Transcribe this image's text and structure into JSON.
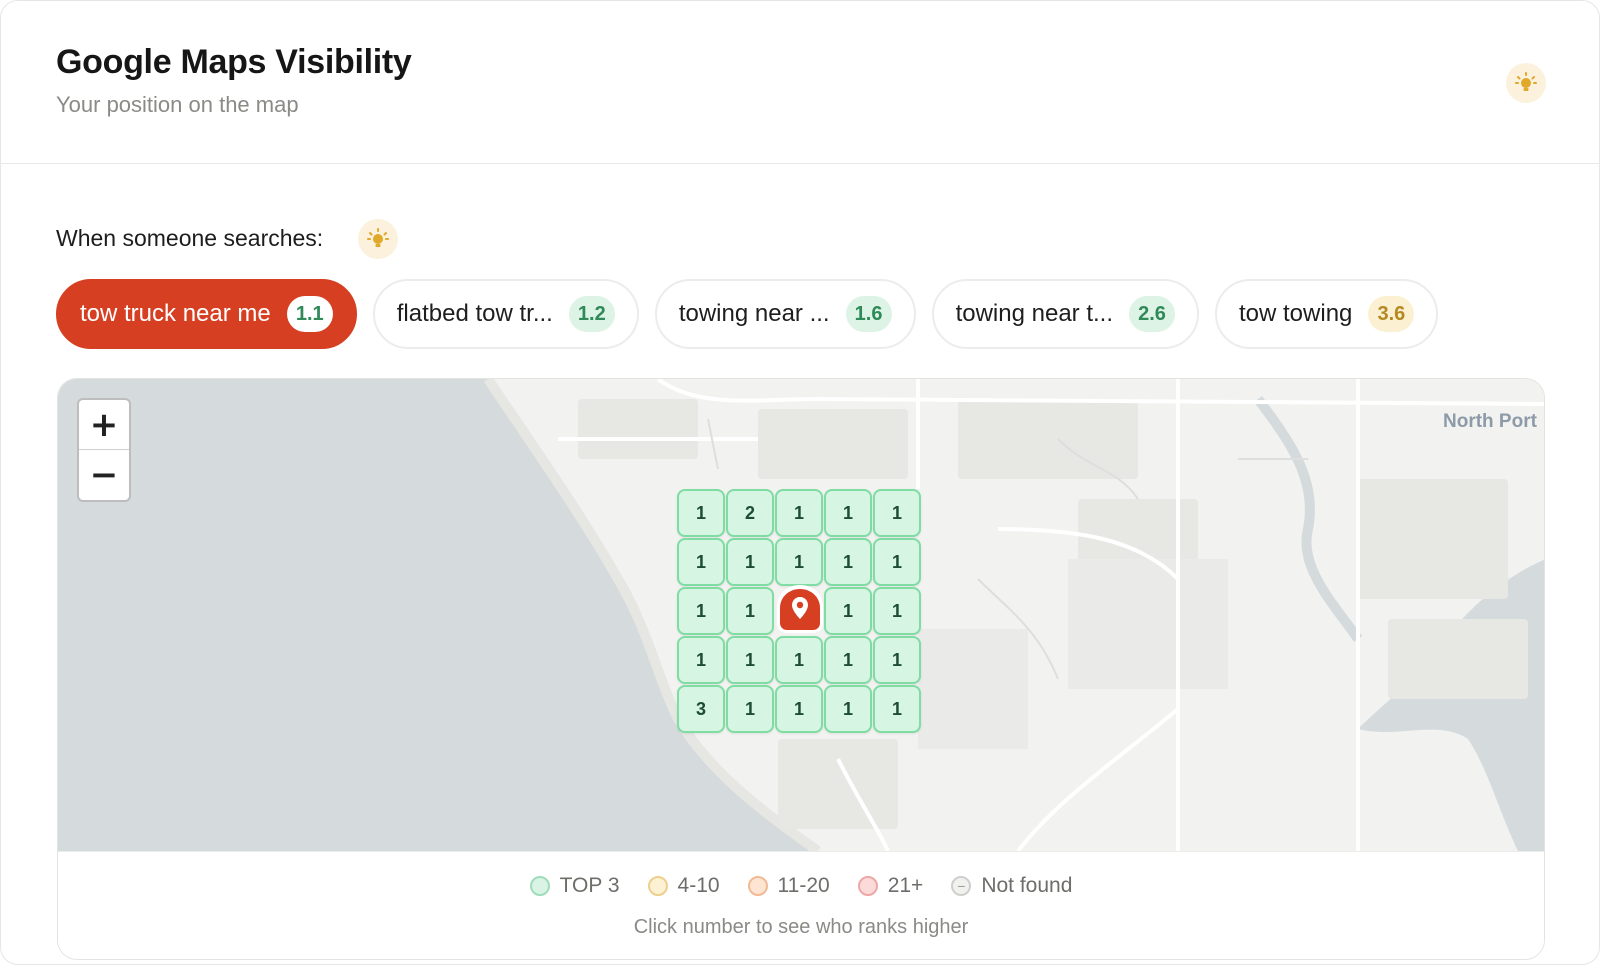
{
  "header": {
    "title": "Google Maps Visibility",
    "subtitle": "Your position on the map",
    "tip_icon": "lightbulb-icon"
  },
  "search": {
    "label": "When someone searches:",
    "tip_icon": "lightbulb-icon"
  },
  "keywords": [
    {
      "label": "tow truck near me",
      "score": "1.1",
      "active": true,
      "score_color": "white"
    },
    {
      "label": "flatbed tow tr...",
      "score": "1.2",
      "active": false,
      "score_color": "green"
    },
    {
      "label": "towing near ...",
      "score": "1.6",
      "active": false,
      "score_color": "green"
    },
    {
      "label": "towing near t...",
      "score": "2.6",
      "active": false,
      "score_color": "green"
    },
    {
      "label": "tow towing",
      "score": "3.6",
      "active": false,
      "score_color": "yellow"
    }
  ],
  "map": {
    "zoom_in": "+",
    "zoom_out": "−",
    "place_label": "North Port",
    "grid": [
      [
        "1",
        "2",
        "1",
        "1",
        "1"
      ],
      [
        "1",
        "1",
        "1",
        "1",
        "1"
      ],
      [
        "1",
        "1",
        "pin",
        "1",
        "1"
      ],
      [
        "1",
        "1",
        "1",
        "1",
        "1"
      ],
      [
        "3",
        "1",
        "1",
        "1",
        "1"
      ]
    ],
    "pin_icon": "location-pin-icon"
  },
  "legend": {
    "items": [
      {
        "label": "TOP 3",
        "fill": "#d9f3e5",
        "stroke": "#9fdcb9"
      },
      {
        "label": "4-10",
        "fill": "#fcf1d3",
        "stroke": "#ecd08c"
      },
      {
        "label": "11-20",
        "fill": "#fde4d3",
        "stroke": "#f1b994"
      },
      {
        "label": "21+",
        "fill": "#fcdada",
        "stroke": "#eda7a7"
      },
      {
        "label": "Not found",
        "fill": "#f1f1ef",
        "stroke": "#cfcfcc",
        "mark": "−"
      }
    ],
    "note": "Click number to see who ranks higher"
  },
  "colors": {
    "accent": "#d63f22",
    "top3_cell_fill": "#d6f5e2",
    "top3_cell_border": "#7fdca3"
  }
}
